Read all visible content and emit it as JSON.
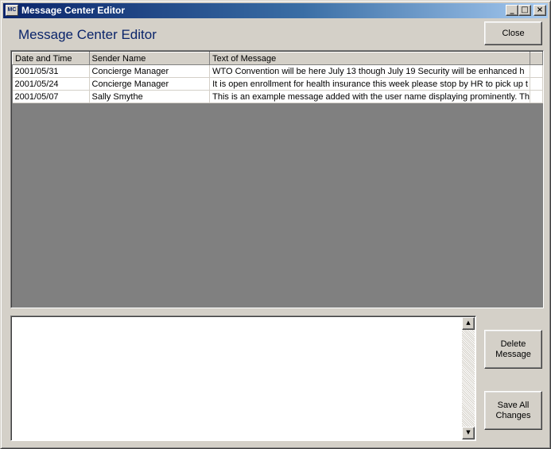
{
  "window": {
    "title": "Message Center Editor",
    "icon_label": "MC",
    "controls": {
      "minimize": "_",
      "maximize": "□",
      "close": "×"
    }
  },
  "header": {
    "label": "Message Center Editor",
    "close_button": "Close"
  },
  "grid": {
    "columns": [
      "Date and Time",
      "Sender Name",
      "Text of Message"
    ],
    "rows": [
      [
        "2001/05/31",
        "Concierge Manager",
        "WTO Convention will be here July 13 though July 19  Security will be enhanced h"
      ],
      [
        "2001/05/24",
        "Concierge Manager",
        "It is open enrollment for health insurance this week please stop by HR to pick up t"
      ],
      [
        "2001/05/07",
        "Sally Smythe",
        "This is an example message added with the user name displaying prominently.  Th"
      ]
    ]
  },
  "editor": {
    "value": "",
    "scroll_up": "▲",
    "scroll_down": "▼"
  },
  "buttons": {
    "delete": "Delete\nMessage",
    "save_all": "Save All\nChanges"
  },
  "colors": {
    "title_gradient_start": "#0a246a",
    "title_gradient_end": "#a6caf0",
    "header_text": "#0a246a",
    "face": "#d4d0c8",
    "grid_empty": "#808080"
  }
}
